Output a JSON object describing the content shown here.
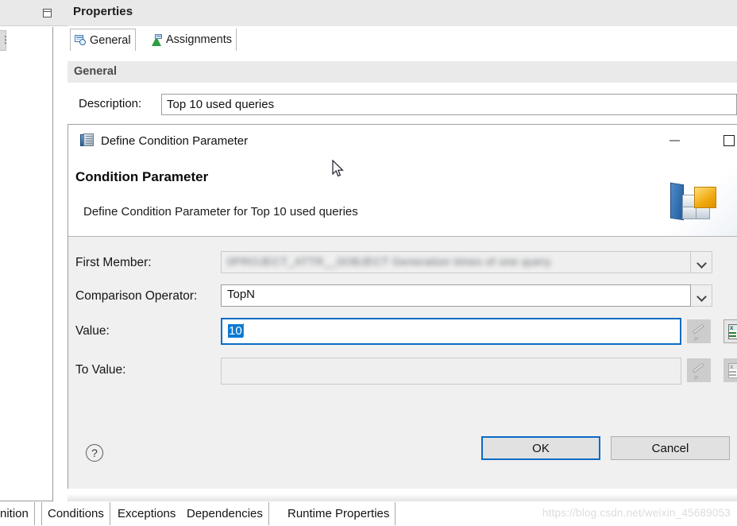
{
  "background": {
    "restore_icon": "restore-window-icon",
    "left_tab_stub_label": "⋮"
  },
  "properties_view": {
    "title": "Properties",
    "tabs": [
      {
        "label": "General",
        "icon": "properties-general-icon",
        "selected": true
      },
      {
        "label": "Assignments",
        "icon": "assignments-triangle-icon",
        "selected": false
      }
    ],
    "section_title": "General",
    "description": {
      "label": "Description:",
      "value": "Top 10 used queries",
      "placeholder": ""
    }
  },
  "dialog": {
    "window_title": "Define Condition Parameter",
    "window_icon": "condition-parameter-book-icon",
    "window_buttons": {
      "minimize": "–",
      "maximize": "□",
      "close": "✕"
    },
    "heading": "Condition Parameter",
    "subheading": "Define Condition Parameter for Top 10 used queries",
    "banner_logo": "sap-bw-banner-logo",
    "fields": {
      "first_member": {
        "label": "First Member:",
        "value": "0PROJECT_ATTR__0OBJECT Generation times of one query",
        "redacted": true,
        "enabled": false,
        "has_dropdown": true
      },
      "comparison_operator": {
        "label": "Comparison Operator:",
        "value": "TopN",
        "enabled": true,
        "has_dropdown": true,
        "options": [
          "TopN"
        ]
      },
      "value": {
        "label": "Value:",
        "value": "10",
        "selected_text": "10",
        "focused": true,
        "enabled": true,
        "edit_button": "pencil-edit-icon",
        "variable_button": "variable-expression-icon"
      },
      "to_value": {
        "label": "To Value:",
        "value": "",
        "placeholder": "",
        "enabled": false,
        "edit_button": "pencil-edit-icon",
        "variable_button": "variable-expression-icon"
      }
    },
    "footer": {
      "help_label": "?",
      "ok_label": "OK",
      "cancel_label": "Cancel",
      "default_button": "OK",
      "focus_color": "#0a6cc4"
    }
  },
  "bottom_tabs": [
    {
      "label": "nition",
      "active": false
    },
    {
      "label": "Conditions",
      "active": true
    },
    {
      "label": "Exceptions",
      "active": false
    },
    {
      "label": "Dependencies",
      "active": false
    },
    {
      "label": "Runtime Properties",
      "active": false
    }
  ],
  "watermark": "https://blog.csdn.net/weixin_45689053",
  "colors": {
    "selection_blue": "#0a7ad4",
    "focus_blue": "#0a6cc4",
    "dialog_bg": "#f0f0f0",
    "band_gray": "#eaeaea",
    "caret_orange": "#c8690f"
  }
}
